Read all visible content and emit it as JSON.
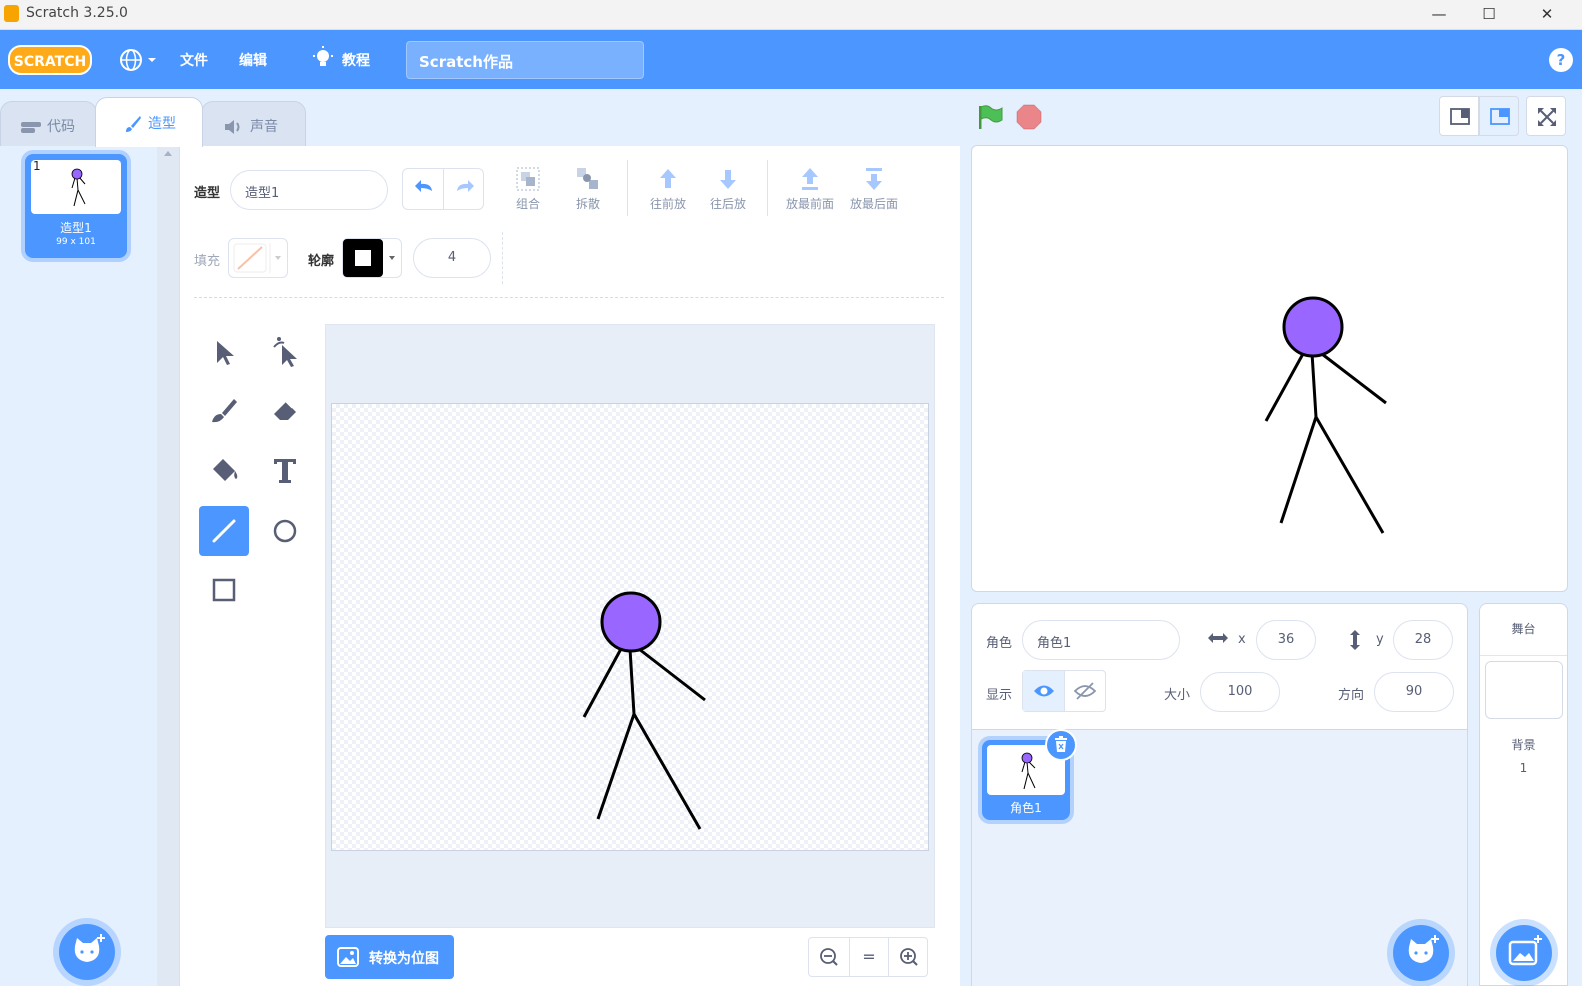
{
  "window": {
    "title": "Scratch 3.25.0",
    "minimize": "—",
    "maximize": "☐",
    "close": "✕"
  },
  "menubar": {
    "logo_text": "SCRATCH",
    "file": "文件",
    "edit": "编辑",
    "tutorials": "教程",
    "project_title": "Scratch作品",
    "help": "?"
  },
  "tabs": {
    "code": "代码",
    "costumes": "造型",
    "sounds": "声音"
  },
  "costume_list": {
    "items": [
      {
        "number": "1",
        "name": "造型1",
        "size": "99 x 101"
      }
    ]
  },
  "editor": {
    "costume_label": "造型",
    "costume_name": "造型1",
    "group": "组合",
    "ungroup": "拆散",
    "forward": "往前放",
    "backward": "往后放",
    "front": "放最前面",
    "back": "放最后面",
    "fill_label": "填充",
    "outline_label": "轮廓",
    "outline_width": "4",
    "convert_bitmap": "转换为位图",
    "zoom_reset": "="
  },
  "sprite_info": {
    "sprite_label": "角色",
    "sprite_name": "角色1",
    "x_label": "x",
    "x": "36",
    "y_label": "y",
    "y": "28",
    "show_label": "显示",
    "size_label": "大小",
    "size": "100",
    "direction_label": "方向",
    "direction": "90"
  },
  "sprites": [
    {
      "name": "角色1"
    }
  ],
  "stage_pane": {
    "title": "舞台",
    "backdrop_label": "背景",
    "backdrop_count": "1"
  },
  "colors": {
    "accent": "#4c97ff",
    "stickman_head": "#9966ff",
    "go_flag": "#4cbf56",
    "stop": "#ec5959"
  }
}
